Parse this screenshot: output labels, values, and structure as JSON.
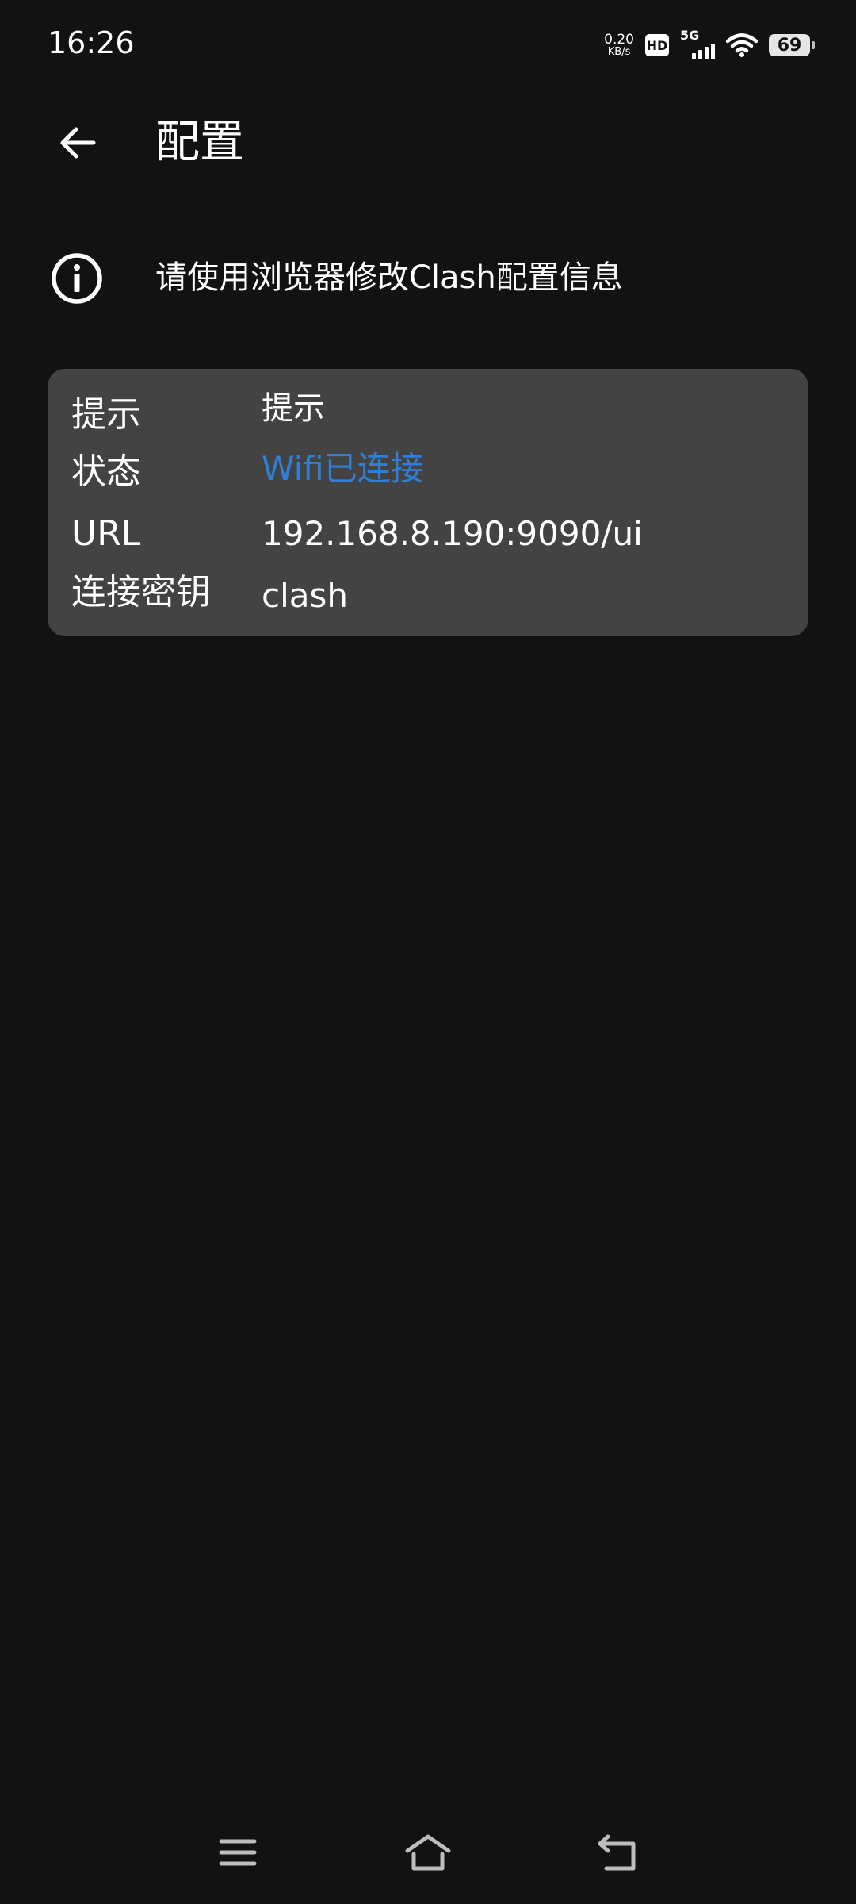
{
  "status_bar": {
    "time": "16:26",
    "net_speed_value": "0.20",
    "net_speed_unit": "KB/s",
    "hd_label": "HD",
    "network_type": "5G",
    "battery_level": "69"
  },
  "app_bar": {
    "title": "配置"
  },
  "info": {
    "text": "请使用浏览器修改Clash配置信息"
  },
  "details": [
    {
      "label": "提示",
      "value": "提示"
    },
    {
      "label": "状态",
      "value": "Wifi已连接"
    },
    {
      "label": "URL",
      "value": "192.168.8.190:9090/ui"
    },
    {
      "label": "连接密钥",
      "value": "clash"
    }
  ],
  "colors": {
    "background": "#121212",
    "card": "#434343",
    "status_connected": "#2f7fd6",
    "text": "#ffffff"
  },
  "icons": {
    "back": "arrow-left-icon",
    "info": "info-circle-icon",
    "nav_menu": "menu-icon",
    "nav_home": "home-icon",
    "nav_back": "back-icon"
  }
}
